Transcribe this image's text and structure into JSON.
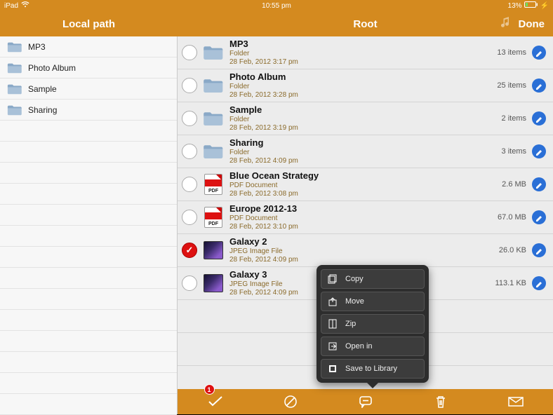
{
  "status": {
    "device": "iPad",
    "time": "10:55 pm",
    "battery": "13%"
  },
  "header": {
    "sidebar_title": "Local path",
    "content_title": "Root",
    "done": "Done"
  },
  "sidebar": {
    "items": [
      {
        "label": "MP3"
      },
      {
        "label": "Photo Album"
      },
      {
        "label": "Sample"
      },
      {
        "label": "Sharing"
      }
    ]
  },
  "files": [
    {
      "name": "MP3",
      "kind": "Folder",
      "date": "28 Feb, 2012 3:17 pm",
      "meta": "13 items",
      "type": "folder",
      "selected": false
    },
    {
      "name": "Photo Album",
      "kind": "Folder",
      "date": "28 Feb, 2012 3:28 pm",
      "meta": "25 items",
      "type": "folder",
      "selected": false
    },
    {
      "name": "Sample",
      "kind": "Folder",
      "date": "28 Feb, 2012 3:19 pm",
      "meta": "2 items",
      "type": "folder",
      "selected": false
    },
    {
      "name": "Sharing",
      "kind": "Folder",
      "date": "28 Feb, 2012 4:09 pm",
      "meta": "3 items",
      "type": "folder",
      "selected": false
    },
    {
      "name": "Blue Ocean Strategy",
      "kind": "PDF Document",
      "date": "28 Feb, 2012 3:08 pm",
      "meta": "2.6 MB",
      "type": "pdf",
      "selected": false
    },
    {
      "name": "Europe 2012-13",
      "kind": "PDF Document",
      "date": "28 Feb, 2012 3:10 pm",
      "meta": "67.0 MB",
      "type": "pdf",
      "selected": false
    },
    {
      "name": "Galaxy 2",
      "kind": "JPEG Image File",
      "date": "28 Feb, 2012 4:09 pm",
      "meta": "26.0 KB",
      "type": "image",
      "selected": true
    },
    {
      "name": "Galaxy 3",
      "kind": "JPEG Image File",
      "date": "28 Feb, 2012 4:09 pm",
      "meta": "113.1 KB",
      "type": "image",
      "selected": false
    }
  ],
  "popover": {
    "items": [
      {
        "label": "Copy"
      },
      {
        "label": "Move"
      },
      {
        "label": "Zip"
      },
      {
        "label": "Open in"
      },
      {
        "label": "Save to Library"
      }
    ]
  },
  "toolbar": {
    "badge": "1"
  },
  "pdf_label": "PDF"
}
